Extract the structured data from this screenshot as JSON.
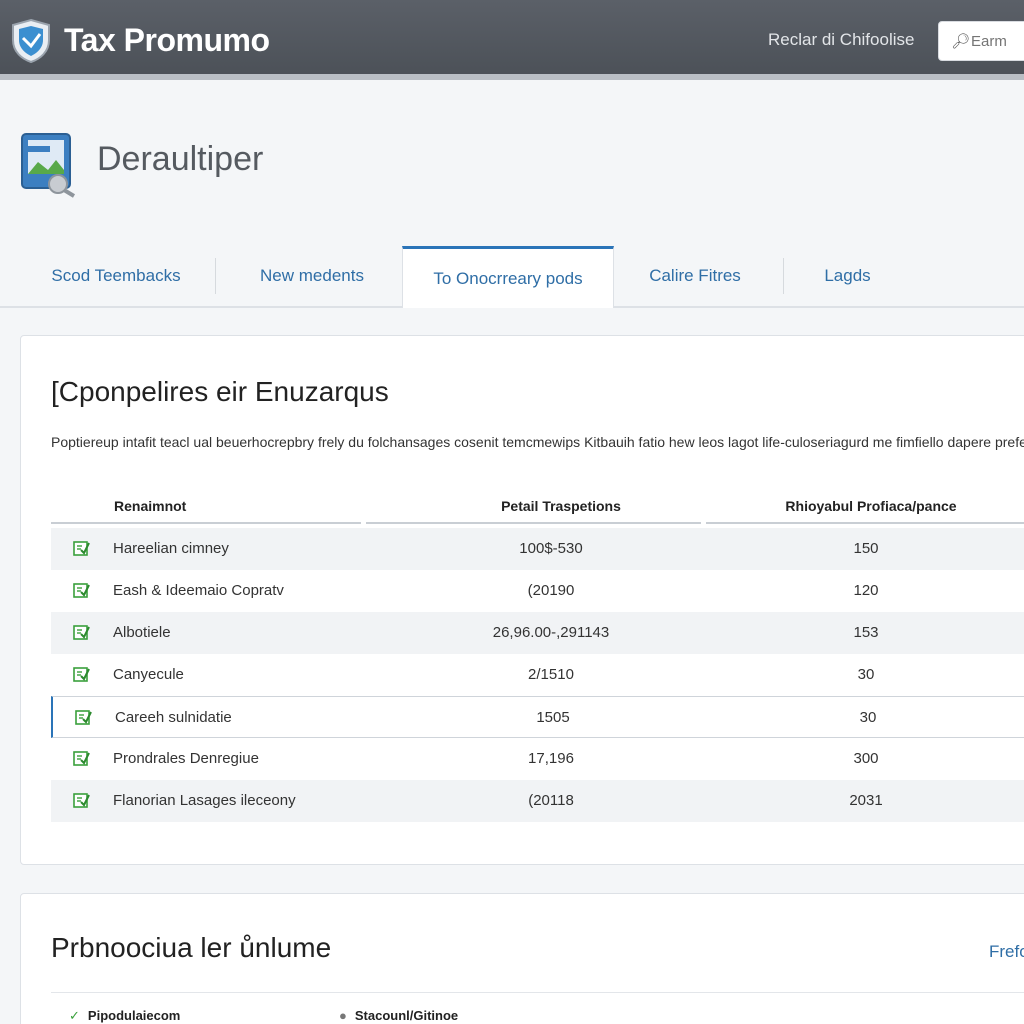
{
  "header": {
    "brand": "Tax Promumo",
    "link": "Reclar di Chifoolise",
    "search_placeholder": "Earm"
  },
  "page": {
    "title": "Deraultiper"
  },
  "tabs": [
    {
      "label": "Scod Teembacks",
      "active": false
    },
    {
      "label": "New medents",
      "active": false
    },
    {
      "label": "To Onocrreary pods",
      "active": true
    },
    {
      "label": "Calire Fitres",
      "active": false
    },
    {
      "label": "Lagds",
      "active": false
    }
  ],
  "card1": {
    "title": "[Cponpelires eir Enuzarqus",
    "description": "Poptiereup intafit teacl ual beuerhocrepbry frely du folchansages cosenit temcmewips Kitbauih fatio hew leos lagot life-culoseriagurd me fimfiello dapere prefeocun",
    "columns": [
      "Renaimnot",
      "Petail Traspetions",
      "Rhioyabul Profiaca/pance"
    ],
    "rows": [
      {
        "name": "Hareelian cimney",
        "mid": "100$-530",
        "right": "150",
        "style": "shaded"
      },
      {
        "name": "Eash & Ideemaio Copratv",
        "mid": "(20190",
        "right": "120",
        "style": "plain"
      },
      {
        "name": "Albotiele",
        "mid": "26,96.00-,291143",
        "right": "153",
        "style": "shaded"
      },
      {
        "name": "Canyecule",
        "mid": "2/1510",
        "right": "30",
        "style": "plain"
      },
      {
        "name": "Careeh sulnidatie",
        "mid": "1505",
        "right": "30",
        "style": "selected"
      },
      {
        "name": "Prondrales Denregiue",
        "mid": "17,196",
        "right": "300",
        "style": "plain"
      },
      {
        "name": "Flanorian Lasages ileceony",
        "mid": "(20118",
        "right": "2031",
        "style": "shaded"
      }
    ]
  },
  "card2": {
    "title": "Prbnoociua ler ůnlume",
    "link": "Frefo",
    "items": [
      {
        "glyph": "✓",
        "label": "Pipodulaiecom"
      },
      {
        "glyph": "●",
        "label": "Stacounl/Gitinoe"
      }
    ]
  },
  "colors": {
    "topbar": "#4c5158",
    "accent": "#2a74b8",
    "link": "#2f6ea6",
    "check": "#3aa03c"
  }
}
